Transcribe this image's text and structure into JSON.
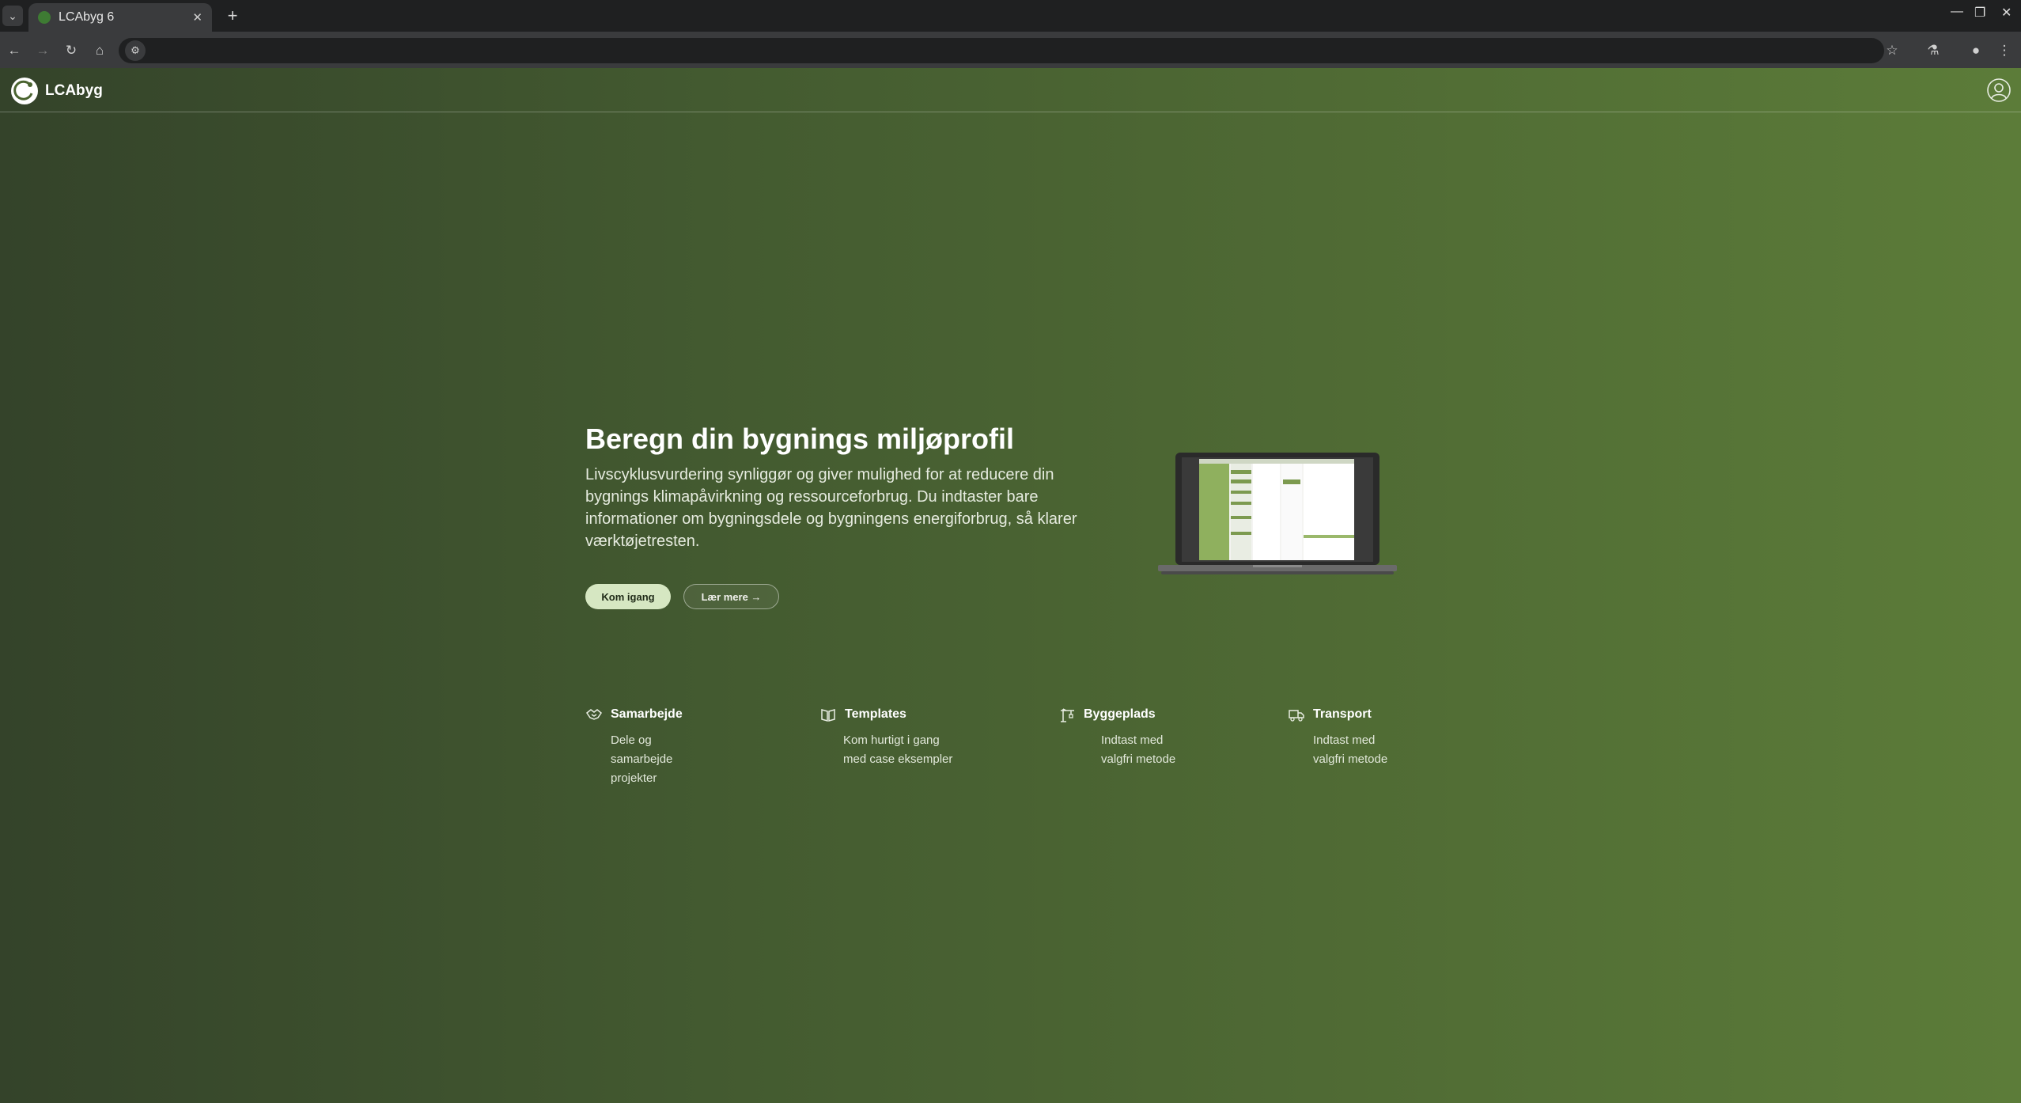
{
  "browser": {
    "tab_title": "LCAbyg 6",
    "tab_close": "✕",
    "new_tab": "+",
    "address": ""
  },
  "app": {
    "logo_text": "LCAbyg"
  },
  "hero": {
    "title": "Beregn din bygnings miljøprofil",
    "description": "Livscyklusvurdering synliggør og giver mulighed for at reducere din bygnings klimapåvirkning og ressourceforbrug. Du indtaster bare informationer om bygningsdele og bygningens energiforbrug, så klarer værktøjetresten.",
    "primary_button": "Kom igang",
    "secondary_button": "Lær mere →"
  },
  "features": [
    {
      "icon": "handshake-icon",
      "title": "Samarbejde",
      "description": "Dele og\nsamarbejde\nprojekter"
    },
    {
      "icon": "book-icon",
      "title": "Templates",
      "description": "Kom hurtigt i gang\nmed case eksempler"
    },
    {
      "icon": "crane-icon",
      "title": "Byggeplads",
      "description": "Indtast med\nvalgfri metode"
    },
    {
      "icon": "truck-icon",
      "title": "Transport",
      "description": "Indtast med\nvalgfri metode"
    }
  ],
  "colors": {
    "gradient_left": "#34432a",
    "gradient_right": "#5c7c39",
    "primary_button_bg": "#d6e7c2"
  }
}
